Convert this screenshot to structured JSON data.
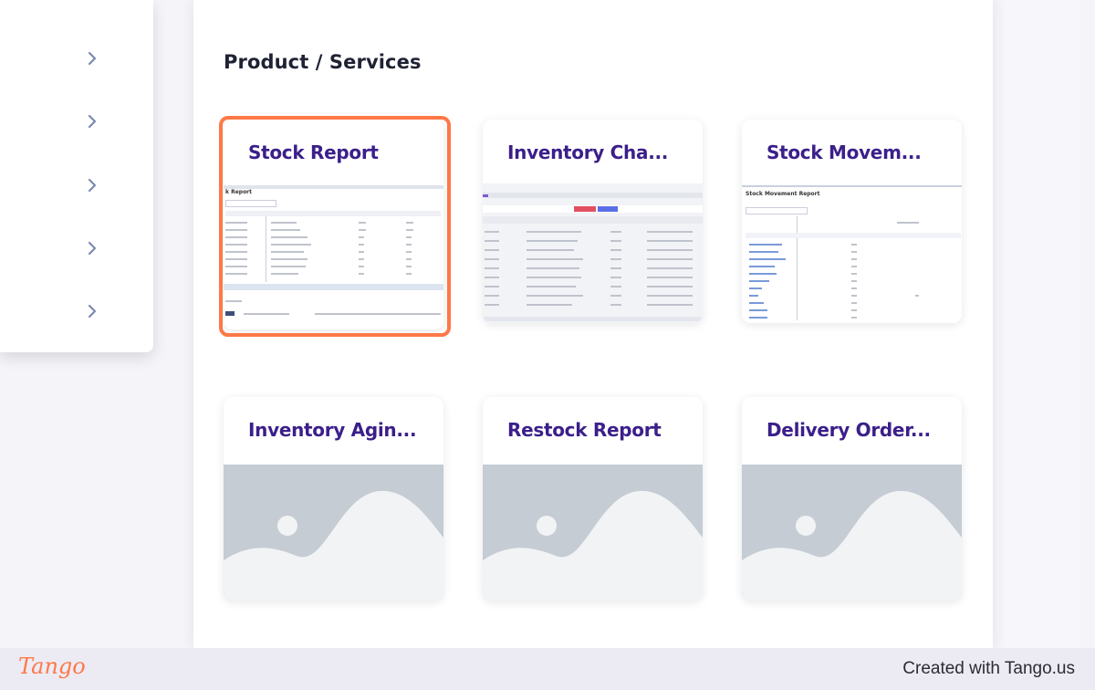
{
  "section_title": "Product / Services",
  "sidebar": {
    "items": [
      {
        "icon": "chevron-right-icon"
      },
      {
        "icon": "chevron-right-icon"
      },
      {
        "icon": "chevron-right-icon"
      },
      {
        "icon": "chevron-right-icon"
      },
      {
        "icon": "chevron-right-icon"
      }
    ]
  },
  "cards": [
    {
      "title": "Stock Report",
      "thumbnail": "screenshot",
      "highlighted": true
    },
    {
      "title": "Inventory Cha...",
      "thumbnail": "screenshot"
    },
    {
      "title": "Stock Movem...",
      "thumbnail": "screenshot"
    },
    {
      "title": "Inventory Agin...",
      "thumbnail": "placeholder-image-icon"
    },
    {
      "title": "Restock Report",
      "thumbnail": "placeholder-image-icon"
    },
    {
      "title": "Delivery Order...",
      "thumbnail": "placeholder-image-icon"
    }
  ],
  "thumbs": {
    "stock_report_label": "k Report",
    "stock_movement_label": "Stock Movement Report"
  },
  "footer": {
    "logo": "Tango",
    "created_text": "Created with Tango.us"
  },
  "colors": {
    "highlight": "#ff7847",
    "card_title": "#3b1f8a",
    "placeholder_bg": "#c5ccd3"
  }
}
